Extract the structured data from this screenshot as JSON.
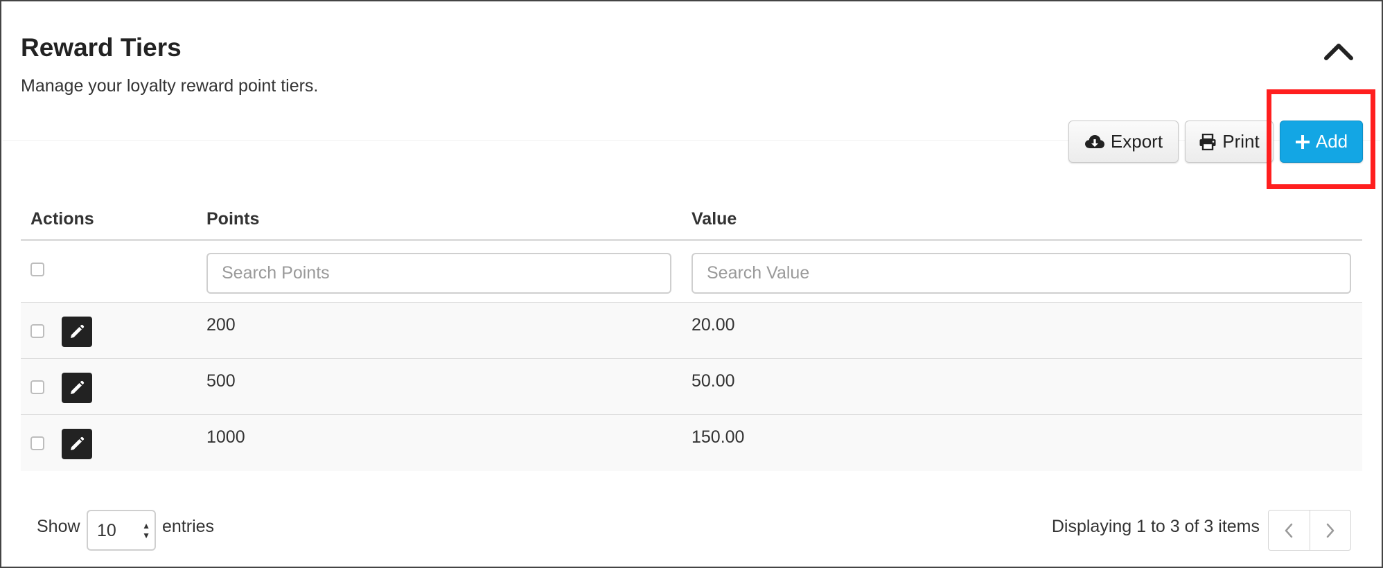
{
  "header": {
    "title": "Reward Tiers",
    "subtitle": "Manage your loyalty reward point tiers."
  },
  "toolbar": {
    "export_label": "Export",
    "print_label": "Print",
    "add_label": "Add",
    "add_color": "#13a6e4"
  },
  "table": {
    "columns": [
      "Actions",
      "Points",
      "Value"
    ],
    "filters": {
      "points_placeholder": "Search Points",
      "value_placeholder": "Search Value"
    },
    "rows": [
      {
        "points": "200",
        "value": "20.00"
      },
      {
        "points": "500",
        "value": "50.00"
      },
      {
        "points": "1000",
        "value": "150.00"
      }
    ]
  },
  "footer": {
    "show_label": "Show",
    "page_size": "10",
    "entries_label": "entries",
    "info_text": "Displaying 1 to 3 of 3 items"
  },
  "icons": {
    "collapse": "chevron-up-icon",
    "export": "cloud-download-icon",
    "print": "printer-icon",
    "add": "plus-icon",
    "edit": "pencil-icon",
    "prev": "chevron-left-icon",
    "next": "chevron-right-icon"
  },
  "annotation": {
    "highlight_color": "#ff1f1f"
  }
}
